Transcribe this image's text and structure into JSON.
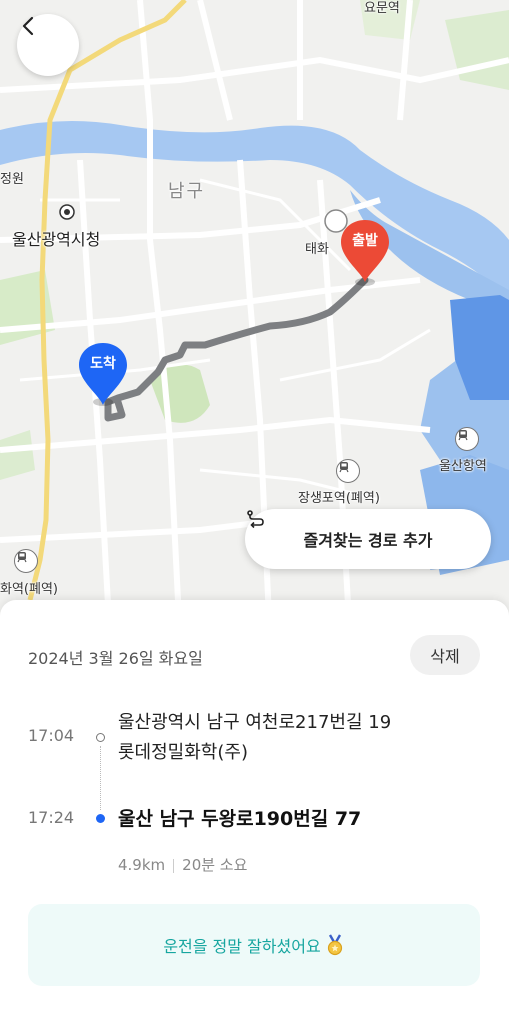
{
  "map": {
    "district_label": "남구",
    "city_hall_label": "울산광역시청",
    "station_taehwa": "태화",
    "station_ulsanhang": "울산항역",
    "station_jangsaengpo": "장생포역(폐역)",
    "station_left": "화역(폐역)",
    "top_label": "요문역",
    "left_edge_label": "정원",
    "start_pin_label": "출발",
    "end_pin_label": "도착",
    "route_color": "#7d7f82",
    "river_color": "#a6c8f2",
    "start_pin_color": "#ec4a36",
    "end_pin_color": "#1e66f5",
    "icons": [
      "chevron-left-icon",
      "route-icon",
      "train-icon",
      "pin-icon"
    ]
  },
  "header": {
    "back_icon": "chevron-left-icon"
  },
  "favorite_button": {
    "label": "즐겨찾는 경로 추가",
    "icon": "route-icon"
  },
  "trip": {
    "date": "2024년 3월 26일 화요일",
    "delete_label": "삭제",
    "start": {
      "time": "17:04",
      "address_line1": "울산광역시 남구 여천로217번길 19",
      "address_line2": "롯데정밀화학(주)"
    },
    "end": {
      "time": "17:24",
      "address": "울산 남구 두왕로190번길 77"
    },
    "distance": "4.9km",
    "duration": "20분 소요"
  },
  "praise": {
    "text": "운전을 정말 잘하셨어요",
    "icon": "medal-icon",
    "accent_color": "#17a6a0"
  }
}
